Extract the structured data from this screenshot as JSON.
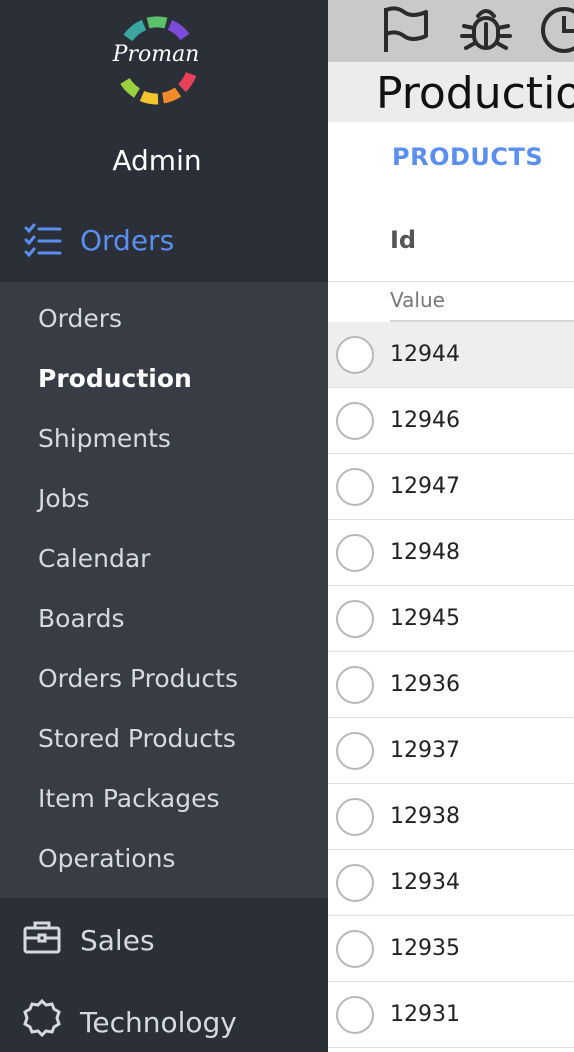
{
  "brand": {
    "logo_text": "Proman",
    "colors": [
      "#3aa6a0",
      "#5bc16b",
      "#7a4ad8",
      "#e8425a",
      "#f28c2a",
      "#f5c52d",
      "#9ad13e",
      "#2f7fd2"
    ]
  },
  "sidebar": {
    "user": "Admin",
    "active_section": {
      "label": "Orders",
      "icon": "checklist-icon"
    },
    "submenu": [
      {
        "label": "Orders",
        "active": false
      },
      {
        "label": "Production",
        "active": true
      },
      {
        "label": "Shipments",
        "active": false
      },
      {
        "label": "Jobs",
        "active": false
      },
      {
        "label": "Calendar",
        "active": false
      },
      {
        "label": "Boards",
        "active": false
      },
      {
        "label": "Orders Products",
        "active": false
      },
      {
        "label": "Stored Products",
        "active": false
      },
      {
        "label": "Item Packages",
        "active": false
      },
      {
        "label": "Operations",
        "active": false
      }
    ],
    "sections": [
      {
        "label": "Sales",
        "icon": "briefcase-icon"
      },
      {
        "label": "Technology",
        "icon": "cog-icon"
      }
    ]
  },
  "toolbar": {
    "icons": [
      "flag-icon",
      "bug-icon",
      "clock-icon"
    ]
  },
  "main": {
    "title": "Production",
    "tab": "PRODUCTS",
    "column_header": "Id",
    "filter_placeholder": "Value",
    "rows": [
      "12944",
      "12946",
      "12947",
      "12948",
      "12945",
      "12936",
      "12937",
      "12938",
      "12934",
      "12935",
      "12931"
    ]
  },
  "colors": {
    "sidebar_bg": "#2b2f37",
    "submenu_bg": "#383c45",
    "accent": "#5a8ff0",
    "toolbar_bg": "#c9c9c9",
    "title_bg": "#ececec"
  }
}
